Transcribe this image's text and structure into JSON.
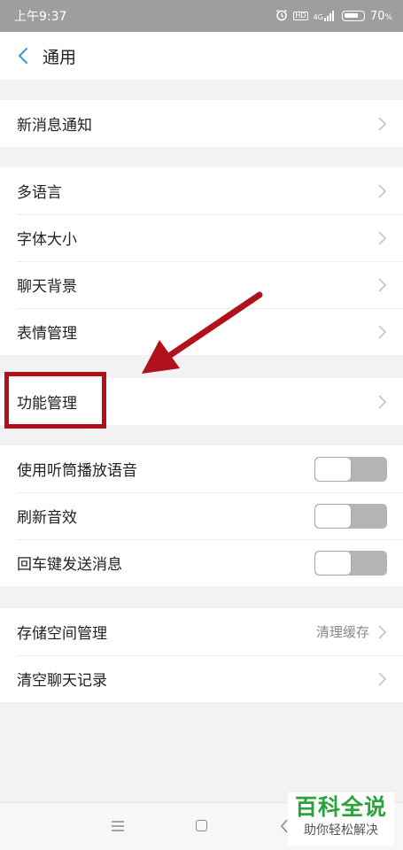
{
  "status_bar": {
    "time": "上午9:37",
    "icons": [
      "alarm-icon",
      "hd-icon",
      "signal-4g-icon",
      "battery-icon"
    ],
    "hd": "HD",
    "network": "4G",
    "battery": "70"
  },
  "header": {
    "title": "通用"
  },
  "sections": {
    "notify": {
      "label": "新消息通知"
    },
    "language": {
      "label": "多语言"
    },
    "font_size": {
      "label": "字体大小"
    },
    "chat_bg": {
      "label": "聊天背景"
    },
    "emoji": {
      "label": "表情管理"
    },
    "features": {
      "label": "功能管理"
    },
    "earpiece": {
      "label": "使用听筒播放语音",
      "on": false
    },
    "refresh_sound": {
      "label": "刷新音效",
      "on": false
    },
    "enter_send": {
      "label": "回车键发送消息",
      "on": false
    },
    "storage": {
      "label": "存储空间管理",
      "value": "清理缓存"
    },
    "clear_history": {
      "label": "清空聊天记录"
    }
  },
  "annotation": {
    "color": "#b0111b"
  },
  "watermark": {
    "title": "百科全说",
    "subtitle": "助你轻松解决",
    "color": "#2aa33a"
  }
}
